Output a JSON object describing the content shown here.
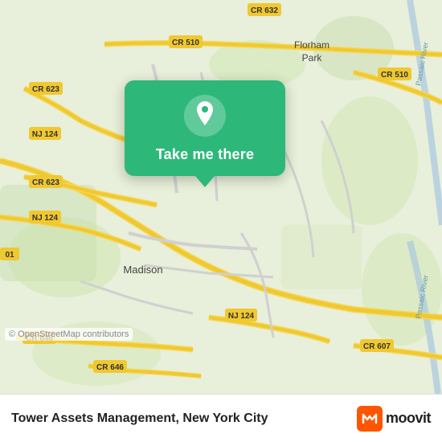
{
  "map": {
    "attribution": "© OpenStreetMap contributors",
    "background_color": "#e8efda"
  },
  "popup": {
    "button_label": "Take me there",
    "icon": "📍"
  },
  "bottom_bar": {
    "business_name": "Tower Assets Management, New York City",
    "moovit_text": "moovit"
  }
}
